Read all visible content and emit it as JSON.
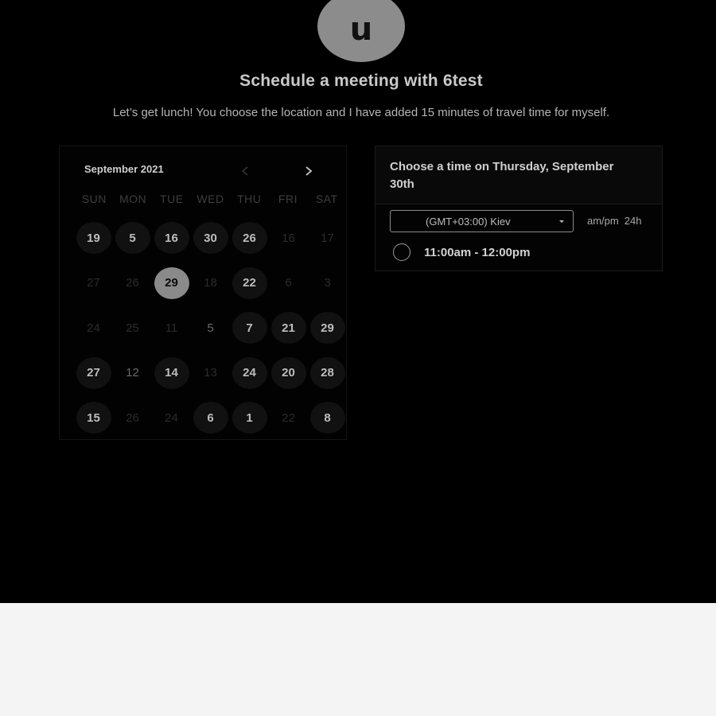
{
  "header": {
    "avatar_letter": "u",
    "title": "Schedule a meeting with 6test",
    "subtitle": "Let’s get lunch! You choose the location and I have added 15 minutes of travel time for myself."
  },
  "calendar": {
    "month_label": "September 2021",
    "prev_icon": "chevron-left-icon",
    "next_icon": "chevron-right-icon",
    "weekdays": [
      "SUN",
      "MON",
      "TUE",
      "WED",
      "THU",
      "FRI",
      "SAT"
    ],
    "days": [
      {
        "label": "19",
        "state": "available"
      },
      {
        "label": "5",
        "state": "available"
      },
      {
        "label": "16",
        "state": "available"
      },
      {
        "label": "30",
        "state": "available"
      },
      {
        "label": "26",
        "state": "available"
      },
      {
        "label": "16",
        "state": "disabled"
      },
      {
        "label": "17",
        "state": "disabled"
      },
      {
        "label": "27",
        "state": "disabled"
      },
      {
        "label": "26",
        "state": "disabled"
      },
      {
        "label": "29",
        "state": "selected"
      },
      {
        "label": "18",
        "state": "disabled"
      },
      {
        "label": "22",
        "state": "available"
      },
      {
        "label": "6",
        "state": "disabled"
      },
      {
        "label": "3",
        "state": "disabled"
      },
      {
        "label": "24",
        "state": "disabled"
      },
      {
        "label": "25",
        "state": "disabled"
      },
      {
        "label": "11",
        "state": "disabled"
      },
      {
        "label": "5",
        "state": "disabled-bright"
      },
      {
        "label": "7",
        "state": "available"
      },
      {
        "label": "21",
        "state": "available"
      },
      {
        "label": "29",
        "state": "available"
      },
      {
        "label": "27",
        "state": "available"
      },
      {
        "label": "12",
        "state": "disabled-bright"
      },
      {
        "label": "14",
        "state": "available"
      },
      {
        "label": "13",
        "state": "disabled"
      },
      {
        "label": "24",
        "state": "available"
      },
      {
        "label": "20",
        "state": "available"
      },
      {
        "label": "28",
        "state": "available"
      },
      {
        "label": "15",
        "state": "available"
      },
      {
        "label": "26",
        "state": "disabled"
      },
      {
        "label": "24",
        "state": "disabled"
      },
      {
        "label": "6",
        "state": "available"
      },
      {
        "label": "1",
        "state": "available"
      },
      {
        "label": "22",
        "state": "disabled"
      },
      {
        "label": "8",
        "state": "available"
      }
    ]
  },
  "time_panel": {
    "title": "Choose a time on Thursday, September 30th",
    "timezone": "(GMT+03:00) Kiev",
    "format_ampm": "am/pm",
    "format_24h": "24h",
    "slots": [
      {
        "label": "11:00am - 12:00pm",
        "selected": false
      }
    ]
  },
  "colors": {
    "background_dark": "#000000",
    "background_light": "#f4f4f4",
    "selected_day": "#8a8a8a",
    "available_day": "#111111"
  }
}
